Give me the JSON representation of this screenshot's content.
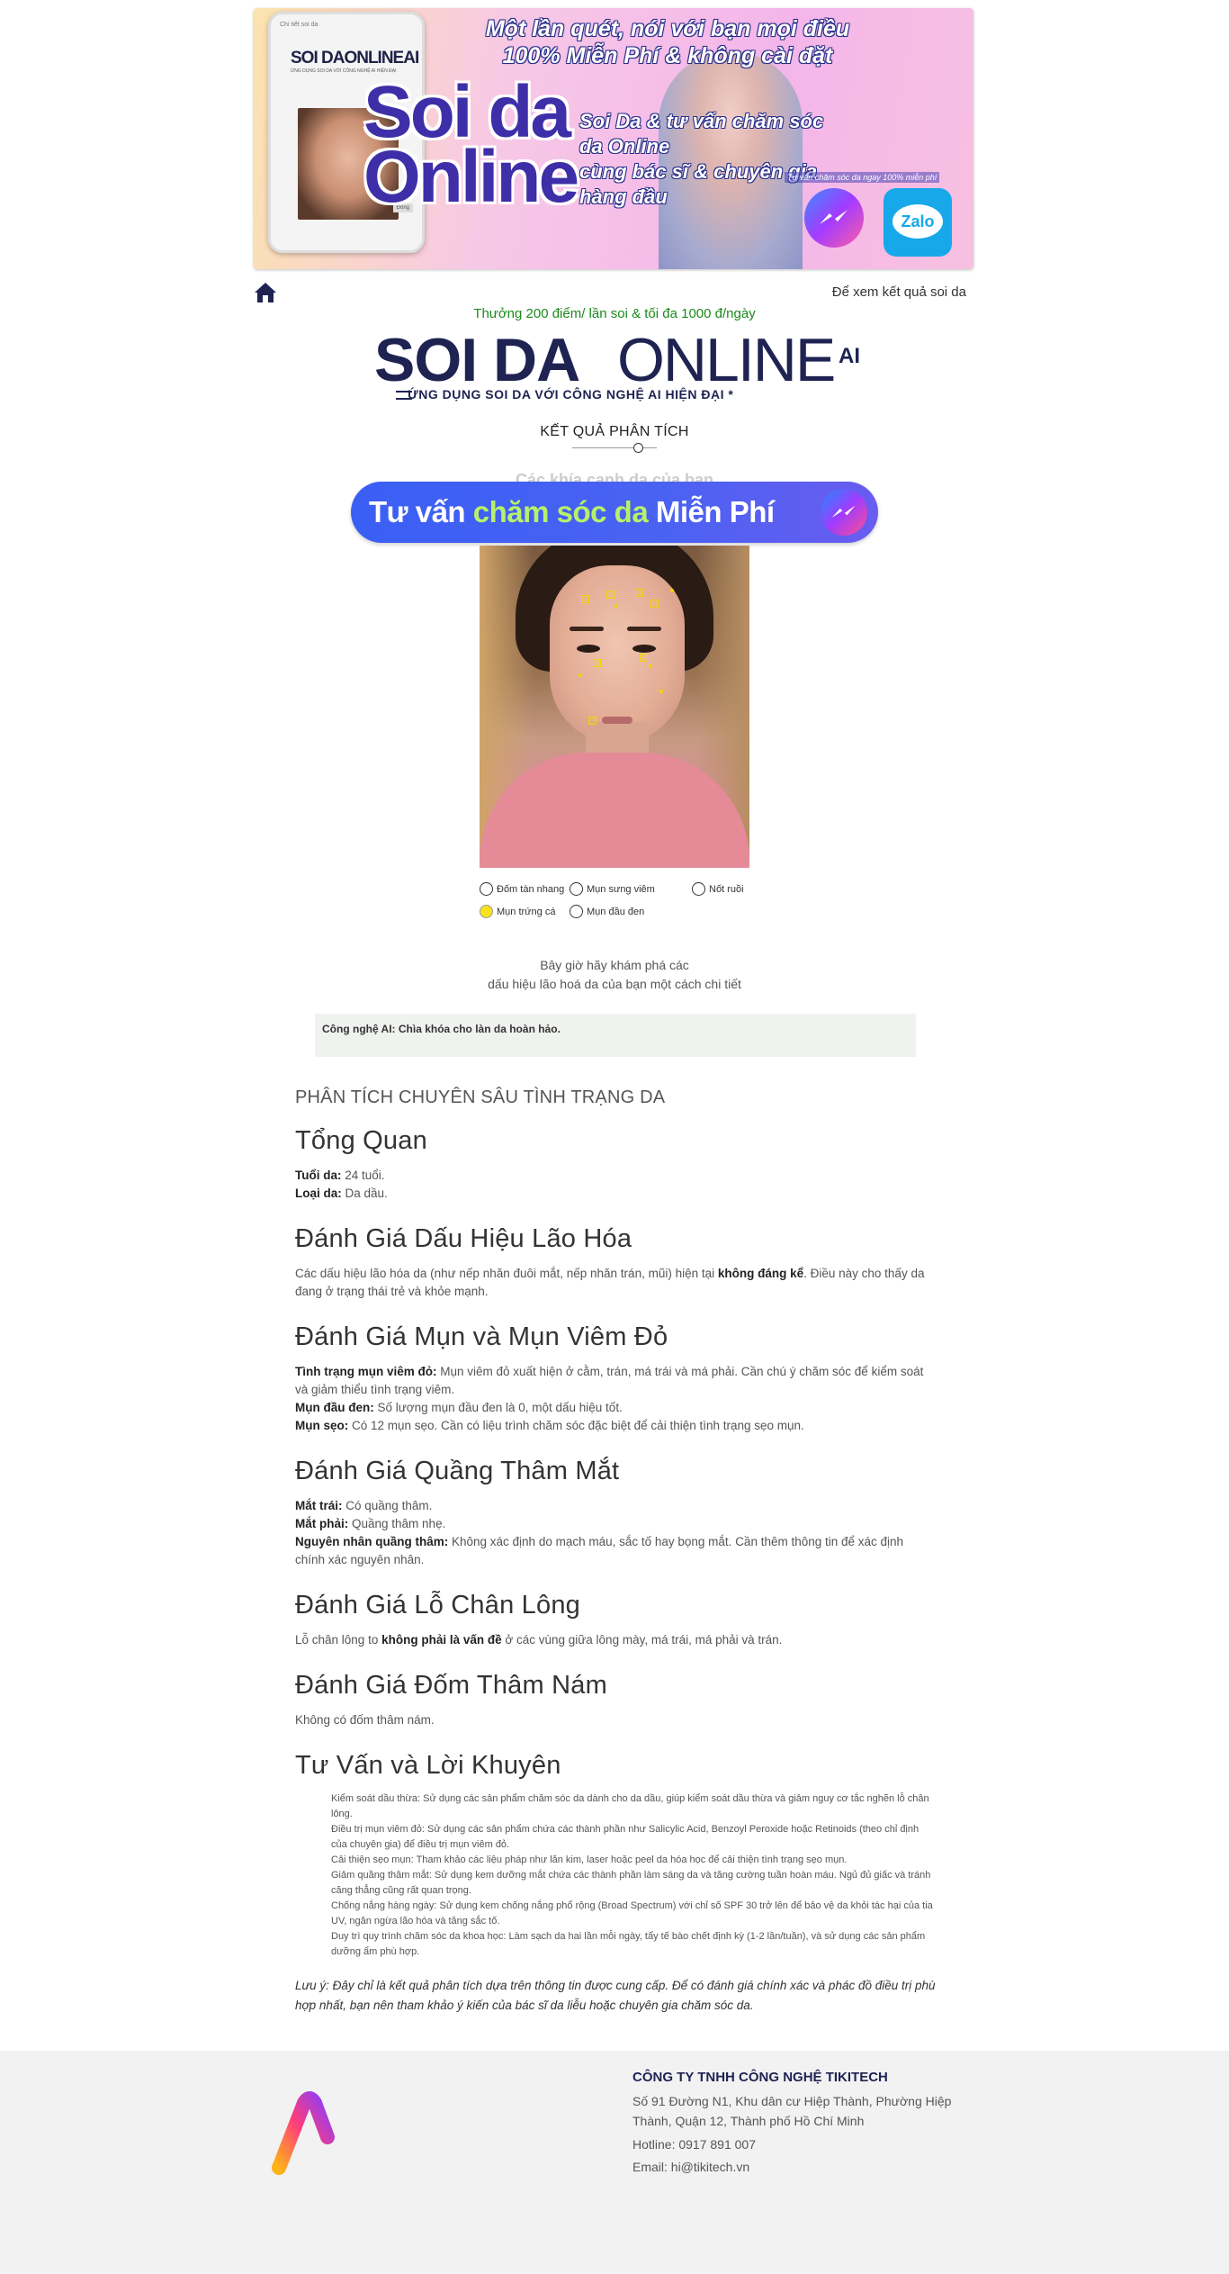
{
  "banner": {
    "phone_title": "Chi tiết soi da",
    "phone_logo": "SOI DAONLINEAI",
    "phone_tagline": "ỨNG DỤNG SOI DA VỚI CÔNG NGHỆ AI HIỆN ĐẠI",
    "phone_button": "Đóng",
    "headline_1": "Một lần quét, nói với bạn mọi điều",
    "headline_2": "100% Miễn Phí & không cài đặt",
    "big_1": "Soi da",
    "big_2": "Online",
    "sub_1": "Soi Da & tư vấn chăm sóc da Online",
    "sub_2": "cùng bác sĩ & chuyên gia hàng đầu",
    "tiny": "Tư vấn chăm sóc da ngay 100% miễn phí",
    "zalo": "Zalo"
  },
  "topbar": {
    "home_icon": "home-icon",
    "result_link": "Để xem kết quả soi da",
    "promo": "Thưởng 200 điểm/ lần soi & tối đa 1000 đ/ngày"
  },
  "logo": {
    "bold": "SOI DA",
    "light": "ONLINE",
    "ai": "AI",
    "tagline": "ỨNG DỤNG SOI DA VỚI CÔNG NGHỆ AI HIỆN ĐẠI *"
  },
  "result": {
    "title": "KẾT QUẢ PHÂN TÍCH",
    "hidden_text": "Các khía cạnh da của bạn"
  },
  "cta": {
    "part1": "Tư vấn ",
    "part2": "chăm sóc da",
    "part3": " Miễn Phí",
    "icon": "messenger-icon"
  },
  "legend": [
    {
      "label": "Đốm tàn nhang",
      "active": false
    },
    {
      "label": "Mụn sưng viêm",
      "active": false
    },
    {
      "label": "Nốt ruồi",
      "active": false
    },
    {
      "label": "Mụn trứng cá",
      "active": true
    },
    {
      "label": "Mụn đầu đen",
      "active": false
    }
  ],
  "explore": {
    "line1": "Bây giờ hãy khám phá các",
    "line2": "dấu hiệu lão hoá da của bạn một cách chi tiết"
  },
  "ai_box": "Công nghệ AI: Chìa khóa cho làn da hoàn hảo.",
  "report": {
    "heading": "PHÂN TÍCH CHUYÊN SÂU TÌNH TRẠNG DA",
    "overview_title": "Tổng Quan",
    "age_label": "Tuổi da:",
    "age_value": " 24 tuổi.",
    "type_label": "Loại da:",
    "type_value": " Da dầu.",
    "aging_title": "Đánh Giá Dấu Hiệu Lão Hóa",
    "aging_pre": "Các dấu hiệu lão hóa da (như nếp nhăn đuôi mắt, nếp nhăn trán, mũi) hiện tại ",
    "aging_bold": "không đáng kể",
    "aging_post": ". Điều này cho thấy da đang ở trạng thái trẻ và khỏe mạnh.",
    "acne_title": "Đánh Giá Mụn và Mụn Viêm Đỏ",
    "acne_inflam_label": "Tình trạng mụn viêm đỏ:",
    "acne_inflam_value": " Mụn viêm đỏ xuất hiện ở cằm, trán, má trái và má phải. Cần chú ý chăm sóc để kiểm soát và giảm thiểu tình trạng viêm.",
    "acne_black_label": "Mụn đầu đen:",
    "acne_black_value": " Số lượng mụn đầu đen là 0, một dấu hiệu tốt.",
    "acne_scar_label": "Mụn sẹo:",
    "acne_scar_value": " Có 12 mụn sẹo. Cần có liệu trình chăm sóc đặc biệt để cải thiện tình trạng sẹo mụn.",
    "dark_title": "Đánh Giá Quầng Thâm Mắt",
    "dark_left_label": "Mắt trái:",
    "dark_left_value": " Có quầng thâm.",
    "dark_right_label": "Mắt phải:",
    "dark_right_value": " Quầng thâm nhẹ.",
    "dark_cause_label": "Nguyên nhân quầng thâm:",
    "dark_cause_value": " Không xác định do mạch máu, sắc tố hay bọng mắt. Cần thêm thông tin để xác định chính xác nguyên nhân.",
    "pore_title": "Đánh Giá Lỗ Chân Lông",
    "pore_pre": "Lỗ chân lông to ",
    "pore_bold": "không phải là vấn đề",
    "pore_post": " ở các vùng giữa lông mày, má trái, má phải và trán.",
    "spot_title": "Đánh Giá Đốm Thâm Nám",
    "spot_text": "Không có đốm thâm nám.",
    "advice_title": "Tư Vấn và Lời Khuyên",
    "advice": [
      "Kiểm soát dầu thừa: Sử dụng các sản phẩm chăm sóc da dành cho da dầu, giúp kiểm soát dầu thừa và giảm nguy cơ tắc nghẽn lỗ chân lông.",
      "Điều trị mụn viêm đỏ: Sử dụng các sản phẩm chứa các thành phần như Salicylic Acid, Benzoyl Peroxide hoặc Retinoids (theo chỉ định của chuyên gia) để điều trị mụn viêm đỏ.",
      "Cải thiện sẹo mụn: Tham khảo các liệu pháp như lăn kim, laser hoặc peel da hóa học để cải thiện tình trạng sẹo mụn.",
      "Giảm quầng thâm mắt: Sử dụng kem dưỡng mắt chứa các thành phần làm sáng da và tăng cường tuần hoàn máu. Ngủ đủ giấc và tránh căng thẳng cũng rất quan trọng.",
      "Chống nắng hàng ngày: Sử dụng kem chống nắng phổ rộng (Broad Spectrum) với chỉ số SPF 30 trở lên để bảo vệ da khỏi tác hại của tia UV, ngăn ngừa lão hóa và tăng sắc tố.",
      "Duy trì quy trình chăm sóc da khoa học: Làm sạch da hai lần mỗi ngày, tẩy tế bào chết định kỳ (1-2 lần/tuần), và sử dụng các sản phẩm dưỡng ẩm phù hợp."
    ],
    "note": "Lưu ý: Đây chỉ là kết quả phân tích dựa trên thông tin được cung cấp. Để có đánh giá chính xác và phác đồ điều trị phù hợp nhất, bạn nên tham khảo ý kiến của bác sĩ da liễu hoặc chuyên gia chăm sóc da."
  },
  "footer": {
    "logo_icon": "ai-logo-icon",
    "company": "CÔNG TY TNHH CÔNG NGHỆ TIKITECH",
    "address": "Số 91 Đường N1, Khu dân cư Hiệp Thành, Phường Hiệp Thành, Quận 12, Thành phố Hồ Chí Minh",
    "hotline": "Hotline: 0917 891 007",
    "email": "Email: hi@tikitech.vn"
  },
  "colors": {
    "brand_navy": "#1e2352",
    "promo_green": "#1b8a1b",
    "cta_blue": "#3a5ff5",
    "cta_green": "#b7f06b",
    "marker_yellow": "#f5d400"
  }
}
